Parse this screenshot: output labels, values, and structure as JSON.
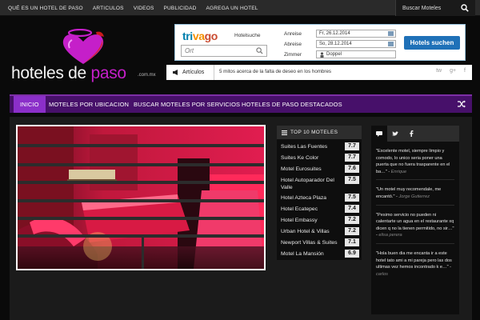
{
  "topnav": {
    "items": [
      "QUÉ ES UN HOTEL DE PASO",
      "ARTICULOS",
      "VIDEOS",
      "PUBLICIDAD",
      "AGREGA UN HOTEL"
    ],
    "search_label": "Buscar Moteles"
  },
  "logo": {
    "word1": "hoteles de ",
    "word2": "paso",
    "tld": ".com.mx"
  },
  "trivago": {
    "brand_a": "tri",
    "brand_b": "va",
    "brand_c": "go",
    "tagline": "Hotelsuche",
    "place_placeholder": "Ort",
    "arrival_label": "Anreise",
    "arrival_value": "Fr, 26.12.2014",
    "departure_label": "Abreise",
    "departure_value": "So, 28.12.2014",
    "room_label": "Zimmer",
    "room_value": "Doppel",
    "button_label": "Hotels suchen"
  },
  "ticker": {
    "tag": "Artículos",
    "headline": "5 mitos acerca de la falta de deseo en los hombres",
    "social": [
      "tw",
      "g+",
      "f"
    ]
  },
  "mainnav": {
    "items": [
      "INICIO",
      "MOTELES POR UBICACION",
      "BUSCAR MOTELES POR SERVICIOS",
      "HOTELES DE PASO DESTACADOS"
    ]
  },
  "top10": {
    "title": "TOP 10 MOTELES",
    "items": [
      {
        "name": "Suites Las Fuentes",
        "score": "7.7"
      },
      {
        "name": "Suites Ke Color",
        "score": "7.7"
      },
      {
        "name": "Motel Eurosuites",
        "score": "7.6"
      },
      {
        "name": "Hotel Autoparador Del Valle",
        "score": "7.5"
      },
      {
        "name": "Hotel Azteca Plaza",
        "score": "7.5"
      },
      {
        "name": "Hotel Ecatepec",
        "score": "7.4"
      },
      {
        "name": "Hotel Embassy",
        "score": "7.2"
      },
      {
        "name": "Urban Hotel & Villas",
        "score": "7.2"
      },
      {
        "name": "Newport Villas & Suites",
        "score": "7.1"
      },
      {
        "name": "Motel La Mansión",
        "score": "6.9"
      }
    ]
  },
  "comments": {
    "items": [
      {
        "text": "\"Excelente motel, siempre limpio y comodo, lo unico seria poner una puerta que no fuera trasparente en el ba…\"",
        "author": "Enrique"
      },
      {
        "text": "\"Un motel muy recomendale, me encantó.\"",
        "author": "Jorge Gutierrez"
      },
      {
        "text": "\"Pesimo servicio no pueden ni calentarte un agua en el restaurante xq dicen q no la tienen permitido, no sir…\"",
        "author": "elisa perera"
      },
      {
        "text": "\"Hola buen dia me encanta ir a este hotel tato ami a mi pareja pero las dos ultimas vez hemos incontrado k e…\"",
        "author": "carlos"
      }
    ]
  },
  "colors": {
    "nav_purple": "#47106a",
    "nav_active": "#8b2fc9",
    "brand_magenta": "#c51fc9",
    "trivago_button": "#1f71b8"
  }
}
